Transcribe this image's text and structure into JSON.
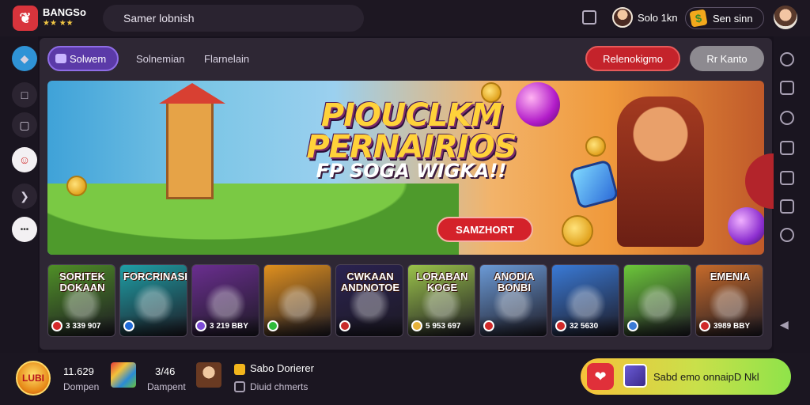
{
  "topbar": {
    "logo_glyph": "❦",
    "logo_title": "BANGSo",
    "logo_sub": "★★ ★★",
    "search_text": "Samer lobnish",
    "user_name": "Solo 1kn",
    "coins_label": "Sen sinn",
    "coin_glyph": "$"
  },
  "tabs": {
    "active": "Solwem",
    "tab2": "Solnemian",
    "tab3": "Flarnelain",
    "red_button": "Relenokigmo",
    "gray_button": "Rr Kanto"
  },
  "banner": {
    "headline_line1": "PIOUCLKM",
    "headline_line2": "PERNAIRIOS",
    "subline": "FP SOGA WIGKA!!",
    "cta": "SAMZHORT"
  },
  "games": [
    {
      "title": "SORITEK DOKAAN",
      "footer": "3 339 907",
      "color": "#4f8f26",
      "badge": "#d62b2b"
    },
    {
      "title": "FORCRINASD",
      "footer": "",
      "color": "#1f9fa6",
      "badge": "#1f6ad6"
    },
    {
      "title": "",
      "footer": "3 219 BBY",
      "color": "#6a2e8f",
      "badge": "#7c4ad6"
    },
    {
      "title": "",
      "footer": "",
      "color": "#e0901e",
      "badge": "#2fbb3a"
    },
    {
      "title": "CWKAAN ANDNOTOE",
      "footer": "",
      "color": "#2a2250",
      "badge": "#c92b2b"
    },
    {
      "title": "LORABAN KOGE",
      "footer": "5 953 697",
      "color": "#9ac24a",
      "badge": "#e6b23a"
    },
    {
      "title": "ANODIA BONBI",
      "footer": "",
      "color": "#6b9ad6",
      "badge": "#d02a2a"
    },
    {
      "title": "",
      "footer": "32 5630",
      "color": "#3a7ad6",
      "badge": "#d02a2a"
    },
    {
      "title": "",
      "footer": "",
      "color": "#6cc73a",
      "badge": "#3a7ad6"
    },
    {
      "title": "EMENIA",
      "footer": "3989 BBY",
      "color": "#c66a2a",
      "badge": "#d02a2a"
    }
  ],
  "bottombar": {
    "logo_text": "LUBI",
    "stat1_value": "11.629",
    "stat1_label": "Dompen",
    "stat2_value": "3/46",
    "stat2_label": "Dampent",
    "feature1": "Sabo Dorierer",
    "feature2": "Diuid chmerts",
    "promo_text": "Sabd emo onnaipD Nkl",
    "promo_glyph": "❤"
  },
  "rail_glyphs": {
    "r1": "◆",
    "r2": "□",
    "r3": "▢",
    "r4": "☺",
    "r5": "❯",
    "r6": "•••",
    "right_arrow": "◀"
  },
  "colors": {
    "accent_purple": "#5b3aa8",
    "accent_red": "#c4232b",
    "gold": "#ffd23a"
  }
}
